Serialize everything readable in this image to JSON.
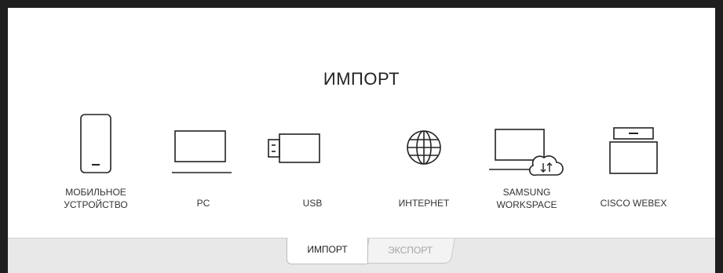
{
  "title": "ИМПОРТ",
  "sources": [
    {
      "name": "mobile",
      "label_line1": "МОБИЛЬНОЕ",
      "label_line2": "УСТРОЙСТВО",
      "icon": "smartphone-icon"
    },
    {
      "name": "pc",
      "label_line1": "PC",
      "label_line2": "",
      "icon": "laptop-icon"
    },
    {
      "name": "usb",
      "label_line1": "USB",
      "label_line2": "",
      "icon": "usb-drive-icon"
    },
    {
      "name": "internet",
      "label_line1": "ИНТЕРНЕТ",
      "label_line2": "",
      "icon": "globe-icon"
    },
    {
      "name": "samsung-workspace",
      "label_line1": "SAMSUNG",
      "label_line2": "WORKSPACE",
      "icon": "laptop-cloud-icon"
    },
    {
      "name": "cisco-webex",
      "label_line1": "CISCO WEBEX",
      "label_line2": "",
      "icon": "webex-device-icon"
    }
  ],
  "tabs": {
    "import_label": "ИМПОРТ",
    "export_label": "ЭКСПОРТ"
  },
  "colors": {
    "background": "#1f1f1f",
    "panel": "#ffffff",
    "bottom_bar": "#e8e8e8",
    "active_tab_text": "#222222",
    "inactive_tab_text": "#a5a5a5"
  }
}
